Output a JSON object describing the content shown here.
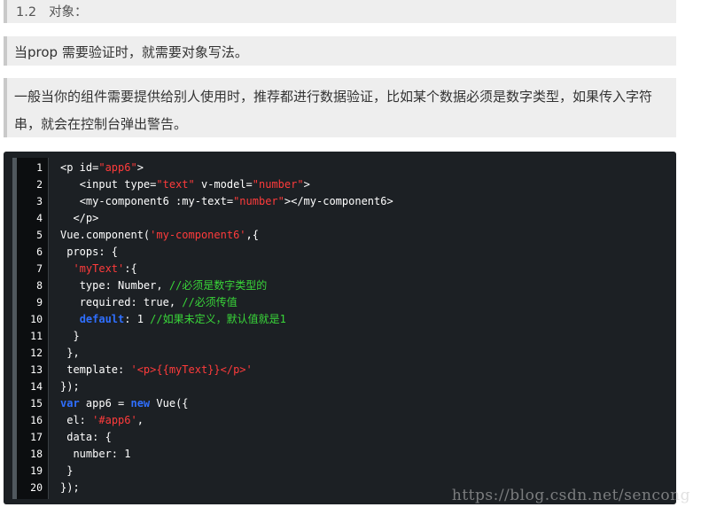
{
  "heading": {
    "number": "1.2",
    "title": "对象："
  },
  "paragraphs": [
    "当prop 需要验证时，就需要对象写法。",
    "一般当你的组件需要提供给别人使用时，推荐都进行数据验证，比如某个数据必须是数字类型，如果传入字符串，就会在控制台弹出警告。"
  ],
  "code": {
    "lines": [
      {
        "n": "1",
        "indent": "",
        "tokens": [
          {
            "t": "<p id=",
            "c": "plain"
          },
          {
            "t": "\"app6\"",
            "c": "str"
          },
          {
            "t": ">",
            "c": "plain"
          }
        ]
      },
      {
        "n": "2",
        "indent": "   ",
        "tokens": [
          {
            "t": "<input type=",
            "c": "plain"
          },
          {
            "t": "\"text\"",
            "c": "str"
          },
          {
            "t": " v-model=",
            "c": "plain"
          },
          {
            "t": "\"number\"",
            "c": "str"
          },
          {
            "t": ">",
            "c": "plain"
          }
        ]
      },
      {
        "n": "3",
        "indent": "   ",
        "tokens": [
          {
            "t": "<my-component6 :my-text=",
            "c": "plain"
          },
          {
            "t": "\"number\"",
            "c": "str"
          },
          {
            "t": "></my-component6>",
            "c": "plain"
          }
        ]
      },
      {
        "n": "4",
        "indent": "  ",
        "tokens": [
          {
            "t": "</p>",
            "c": "plain"
          }
        ]
      },
      {
        "n": "5",
        "indent": "",
        "tokens": [
          {
            "t": "Vue.component(",
            "c": "plain"
          },
          {
            "t": "'my-component6'",
            "c": "str"
          },
          {
            "t": ",{",
            "c": "plain"
          }
        ]
      },
      {
        "n": "6",
        "indent": " ",
        "tokens": [
          {
            "t": "props: {",
            "c": "plain"
          }
        ]
      },
      {
        "n": "7",
        "indent": "  ",
        "tokens": [
          {
            "t": "'myText'",
            "c": "str"
          },
          {
            "t": ":{",
            "c": "plain"
          }
        ]
      },
      {
        "n": "8",
        "indent": "   ",
        "tokens": [
          {
            "t": "type: Number, ",
            "c": "plain"
          },
          {
            "t": "//必须是数字类型的",
            "c": "cm"
          }
        ]
      },
      {
        "n": "9",
        "indent": "   ",
        "tokens": [
          {
            "t": "required: true, ",
            "c": "plain"
          },
          {
            "t": "//必须传值",
            "c": "cm"
          }
        ]
      },
      {
        "n": "10",
        "indent": "   ",
        "tokens": [
          {
            "t": "default",
            "c": "kw"
          },
          {
            "t": ": 1 ",
            "c": "plain"
          },
          {
            "t": "//如果未定义，默认值就是1",
            "c": "cm"
          }
        ]
      },
      {
        "n": "11",
        "indent": "  ",
        "tokens": [
          {
            "t": "}",
            "c": "plain"
          }
        ]
      },
      {
        "n": "12",
        "indent": " ",
        "tokens": [
          {
            "t": "},",
            "c": "plain"
          }
        ]
      },
      {
        "n": "13",
        "indent": " ",
        "tokens": [
          {
            "t": "template: ",
            "c": "plain"
          },
          {
            "t": "'<p>{{myText}}</p>'",
            "c": "str"
          }
        ]
      },
      {
        "n": "14",
        "indent": "",
        "tokens": [
          {
            "t": "});",
            "c": "plain"
          }
        ]
      },
      {
        "n": "15",
        "indent": "",
        "tokens": [
          {
            "t": "var",
            "c": "kw"
          },
          {
            "t": " app6 = ",
            "c": "plain"
          },
          {
            "t": "new",
            "c": "kw"
          },
          {
            "t": " Vue({",
            "c": "plain"
          }
        ]
      },
      {
        "n": "16",
        "indent": " ",
        "tokens": [
          {
            "t": "el: ",
            "c": "plain"
          },
          {
            "t": "'#app6'",
            "c": "str"
          },
          {
            "t": ",",
            "c": "plain"
          }
        ]
      },
      {
        "n": "17",
        "indent": " ",
        "tokens": [
          {
            "t": "data: {",
            "c": "plain"
          }
        ]
      },
      {
        "n": "18",
        "indent": "  ",
        "tokens": [
          {
            "t": "number: 1",
            "c": "plain"
          }
        ]
      },
      {
        "n": "19",
        "indent": " ",
        "tokens": [
          {
            "t": "}",
            "c": "plain"
          }
        ]
      },
      {
        "n": "20",
        "indent": "",
        "tokens": [
          {
            "t": "});",
            "c": "plain"
          }
        ]
      }
    ],
    "colors": {
      "background": "#1c2024",
      "string": "#ff3b3b",
      "keyword": "#2f6fff",
      "comment": "#39d639",
      "plain": "#ffffff"
    }
  },
  "watermark": "https://blog.csdn.net/sencong"
}
